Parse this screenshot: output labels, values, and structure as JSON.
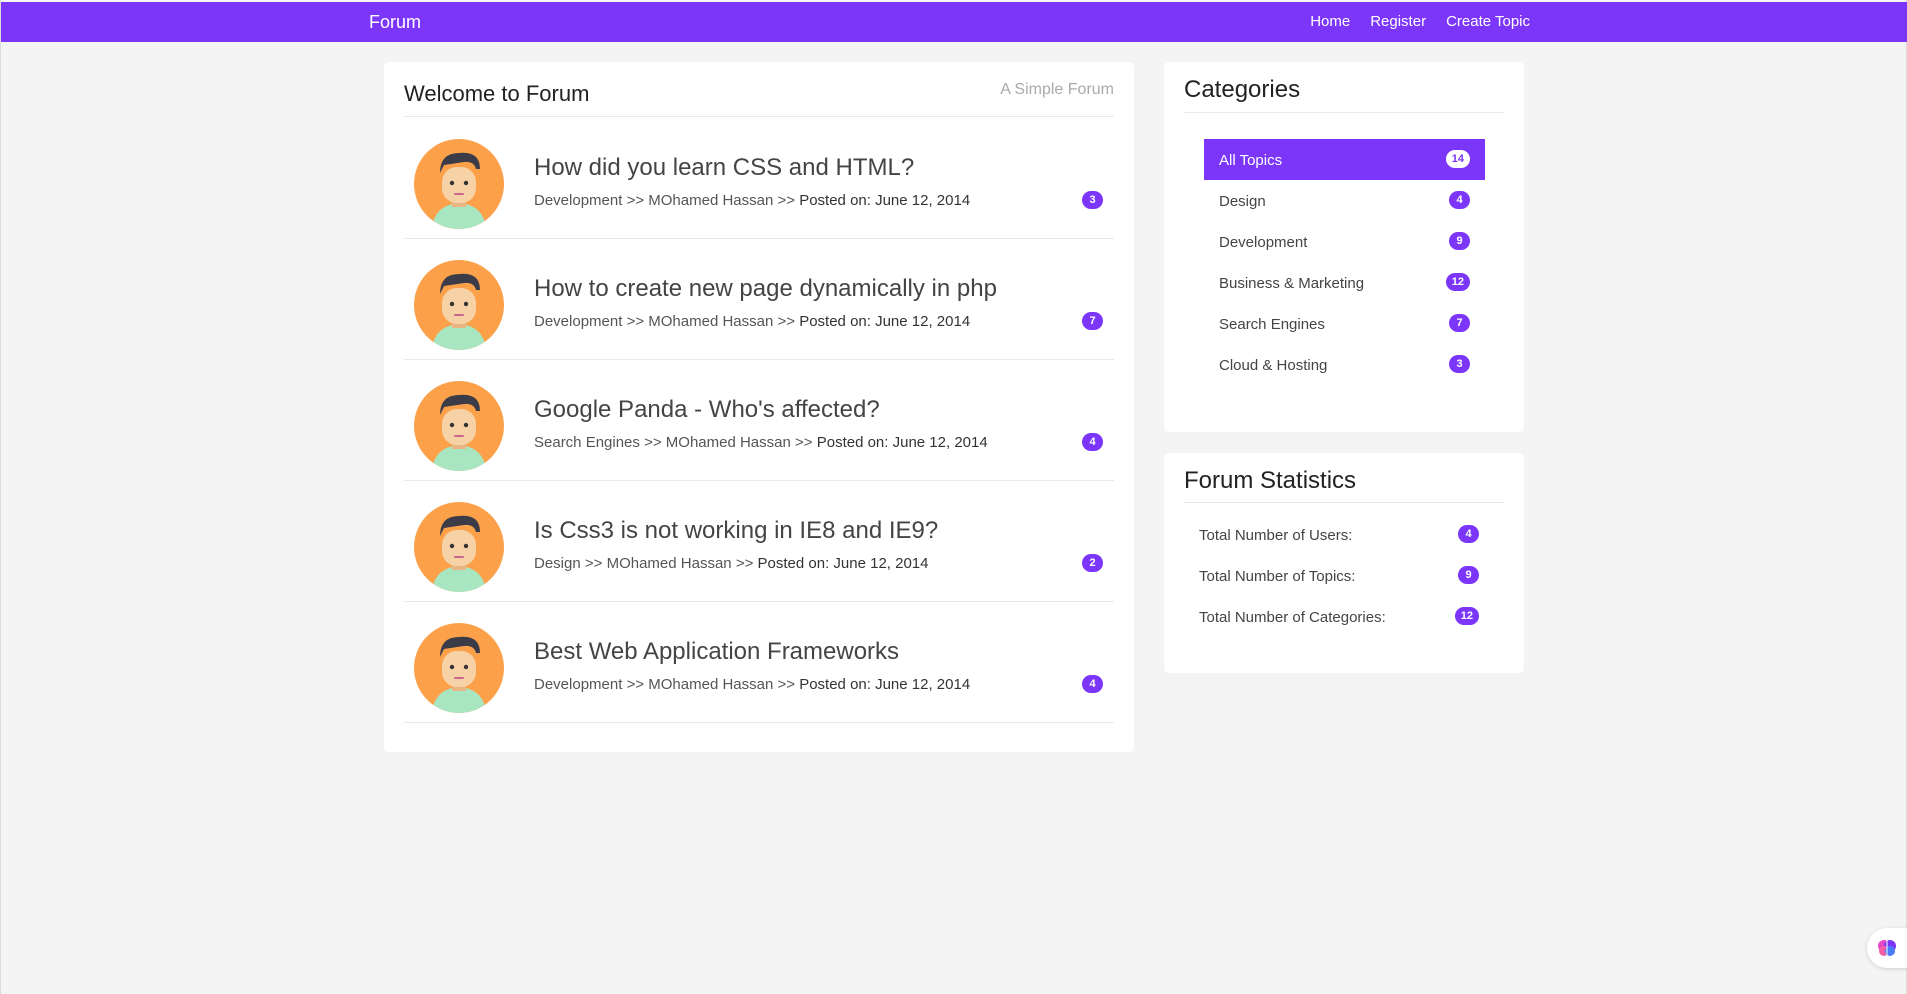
{
  "navbar": {
    "brand": "Forum",
    "links": [
      "Home",
      "Register",
      "Create Topic"
    ],
    "color": "#7b36fa"
  },
  "main": {
    "title": "Welcome to Forum",
    "subtitle": "A Simple Forum",
    "topics": [
      {
        "title": "How did you learn CSS and HTML?",
        "category": "Development",
        "author": "MOhamed Hassan",
        "posted": "Posted on: June 12, 2014",
        "replies": "3"
      },
      {
        "title": "How to create new page dynamically in php",
        "category": "Development",
        "author": "MOhamed Hassan",
        "posted": "Posted on: June 12, 2014",
        "replies": "7"
      },
      {
        "title": "Google Panda - Who's affected?",
        "category": "Search Engines",
        "author": "MOhamed Hassan",
        "posted": "Posted on: June 12, 2014",
        "replies": "4"
      },
      {
        "title": "Is Css3 is not working in IE8 and IE9?",
        "category": "Design",
        "author": "MOhamed Hassan",
        "posted": "Posted on: June 12, 2014",
        "replies": "2"
      },
      {
        "title": "Best Web Application Frameworks",
        "category": "Development",
        "author": "MOhamed Hassan",
        "posted": "Posted on: June 12, 2014",
        "replies": "4"
      }
    ],
    "separator": ">>"
  },
  "categories": {
    "title": "Categories",
    "items": [
      {
        "label": "All Topics",
        "count": "14",
        "active": true
      },
      {
        "label": "Design",
        "count": "4"
      },
      {
        "label": "Development",
        "count": "9"
      },
      {
        "label": "Business & Marketing",
        "count": "12"
      },
      {
        "label": "Search Engines",
        "count": "7"
      },
      {
        "label": "Cloud & Hosting",
        "count": "3"
      }
    ]
  },
  "stats": {
    "title": "Forum Statistics",
    "items": [
      {
        "label": "Total Number of Users:",
        "count": "4"
      },
      {
        "label": "Total Number of Topics:",
        "count": "9"
      },
      {
        "label": "Total Number of Categories:",
        "count": "12"
      }
    ]
  },
  "icons": {
    "avatar": "user-avatar-icon",
    "assistant": "brain-icon"
  }
}
